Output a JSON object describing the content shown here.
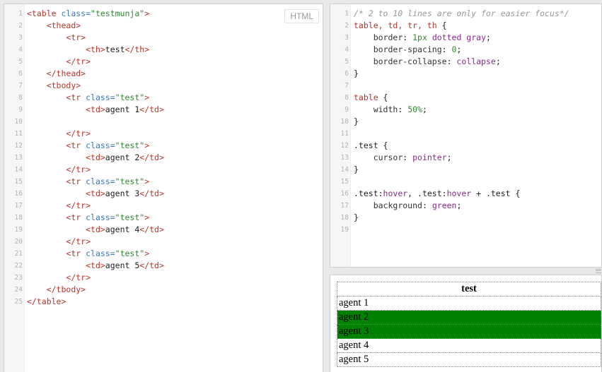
{
  "html_editor": {
    "badge": "HTML",
    "lines": [
      {
        "n": "1",
        "seg": [
          [
            "tag",
            "<table "
          ],
          [
            "attr",
            "class="
          ],
          [
            "str",
            "\"testmunja\""
          ],
          [
            "tag",
            ">"
          ]
        ]
      },
      {
        "n": "2",
        "seg": [
          [
            "plain",
            "    "
          ],
          [
            "tag",
            "<thead>"
          ]
        ]
      },
      {
        "n": "3",
        "seg": [
          [
            "plain",
            "        "
          ],
          [
            "tag",
            "<tr>"
          ]
        ]
      },
      {
        "n": "4",
        "seg": [
          [
            "plain",
            "            "
          ],
          [
            "tag",
            "<th>"
          ],
          [
            "plain",
            "test"
          ],
          [
            "tag",
            "</th>"
          ]
        ]
      },
      {
        "n": "5",
        "seg": [
          [
            "plain",
            "        "
          ],
          [
            "tag",
            "</tr>"
          ]
        ]
      },
      {
        "n": "6",
        "seg": [
          [
            "plain",
            "    "
          ],
          [
            "tag",
            "</thead>"
          ]
        ]
      },
      {
        "n": "7",
        "seg": [
          [
            "plain",
            "    "
          ],
          [
            "tag",
            "<tbody>"
          ]
        ]
      },
      {
        "n": "8",
        "seg": [
          [
            "plain",
            "        "
          ],
          [
            "tag",
            "<tr "
          ],
          [
            "attr",
            "class="
          ],
          [
            "str",
            "\"test\""
          ],
          [
            "tag",
            ">"
          ]
        ]
      },
      {
        "n": "9",
        "seg": [
          [
            "plain",
            "            "
          ],
          [
            "tag",
            "<td>"
          ],
          [
            "plain",
            "agent 1"
          ],
          [
            "tag",
            "</td>"
          ]
        ]
      },
      {
        "n": "10",
        "seg": []
      },
      {
        "n": "11",
        "seg": [
          [
            "plain",
            "        "
          ],
          [
            "tag",
            "</tr>"
          ]
        ]
      },
      {
        "n": "12",
        "seg": [
          [
            "plain",
            "        "
          ],
          [
            "tag",
            "<tr "
          ],
          [
            "attr",
            "class="
          ],
          [
            "str",
            "\"test\""
          ],
          [
            "tag",
            ">"
          ]
        ]
      },
      {
        "n": "13",
        "seg": [
          [
            "plain",
            "            "
          ],
          [
            "tag",
            "<td>"
          ],
          [
            "plain",
            "agent 2"
          ],
          [
            "tag",
            "</td>"
          ]
        ]
      },
      {
        "n": "14",
        "seg": [
          [
            "plain",
            "        "
          ],
          [
            "tag",
            "</tr>"
          ]
        ]
      },
      {
        "n": "15",
        "seg": [
          [
            "plain",
            "        "
          ],
          [
            "tag",
            "<tr "
          ],
          [
            "attr",
            "class="
          ],
          [
            "str",
            "\"test\""
          ],
          [
            "tag",
            ">"
          ]
        ]
      },
      {
        "n": "16",
        "seg": [
          [
            "plain",
            "            "
          ],
          [
            "tag",
            "<td>"
          ],
          [
            "plain",
            "agent 3"
          ],
          [
            "tag",
            "</td>"
          ]
        ]
      },
      {
        "n": "17",
        "seg": [
          [
            "plain",
            "        "
          ],
          [
            "tag",
            "</tr>"
          ]
        ]
      },
      {
        "n": "18",
        "seg": [
          [
            "plain",
            "        "
          ],
          [
            "tag",
            "<tr "
          ],
          [
            "attr",
            "class="
          ],
          [
            "str",
            "\"test\""
          ],
          [
            "tag",
            ">"
          ]
        ]
      },
      {
        "n": "19",
        "seg": [
          [
            "plain",
            "            "
          ],
          [
            "tag",
            "<td>"
          ],
          [
            "plain",
            "agent 4"
          ],
          [
            "tag",
            "</td>"
          ]
        ]
      },
      {
        "n": "20",
        "seg": [
          [
            "plain",
            "        "
          ],
          [
            "tag",
            "</tr>"
          ]
        ]
      },
      {
        "n": "21",
        "seg": [
          [
            "plain",
            "        "
          ],
          [
            "tag",
            "<tr "
          ],
          [
            "attr",
            "class="
          ],
          [
            "str",
            "\"test\""
          ],
          [
            "tag",
            ">"
          ]
        ]
      },
      {
        "n": "22",
        "seg": [
          [
            "plain",
            "            "
          ],
          [
            "tag",
            "<td>"
          ],
          [
            "plain",
            "agent 5"
          ],
          [
            "tag",
            "</td>"
          ]
        ]
      },
      {
        "n": "23",
        "seg": [
          [
            "plain",
            "        "
          ],
          [
            "tag",
            "</tr>"
          ]
        ]
      },
      {
        "n": "24",
        "seg": [
          [
            "plain",
            "    "
          ],
          [
            "tag",
            "</tbody>"
          ]
        ]
      },
      {
        "n": "25",
        "seg": [
          [
            "tag",
            "</table>"
          ]
        ]
      }
    ]
  },
  "css_editor": {
    "lines": [
      {
        "n": "1",
        "seg": [
          [
            "com",
            "/* 2 to 10 lines are only for easier focus*/"
          ]
        ]
      },
      {
        "n": "2",
        "seg": [
          [
            "sel",
            "table, td, tr, th"
          ],
          [
            "plain",
            " {"
          ]
        ]
      },
      {
        "n": "3",
        "seg": [
          [
            "plain",
            "    "
          ],
          [
            "prop",
            "border"
          ],
          [
            "plain",
            ": "
          ],
          [
            "num",
            "1px"
          ],
          [
            "plain",
            " "
          ],
          [
            "val",
            "dotted gray"
          ],
          [
            "plain",
            ";"
          ]
        ]
      },
      {
        "n": "4",
        "seg": [
          [
            "plain",
            "    "
          ],
          [
            "prop",
            "border-spacing"
          ],
          [
            "plain",
            ": "
          ],
          [
            "num",
            "0"
          ],
          [
            "plain",
            ";"
          ]
        ]
      },
      {
        "n": "5",
        "seg": [
          [
            "plain",
            "    "
          ],
          [
            "prop",
            "border-collapse"
          ],
          [
            "plain",
            ": "
          ],
          [
            "val",
            "collapse"
          ],
          [
            "plain",
            ";"
          ]
        ]
      },
      {
        "n": "6",
        "seg": [
          [
            "plain",
            "}"
          ]
        ]
      },
      {
        "n": "7",
        "seg": []
      },
      {
        "n": "8",
        "seg": [
          [
            "sel",
            "table"
          ],
          [
            "plain",
            " {"
          ]
        ]
      },
      {
        "n": "9",
        "seg": [
          [
            "plain",
            "    "
          ],
          [
            "prop",
            "width"
          ],
          [
            "plain",
            ": "
          ],
          [
            "num",
            "50%"
          ],
          [
            "plain",
            ";"
          ]
        ]
      },
      {
        "n": "10",
        "seg": [
          [
            "plain",
            "}"
          ]
        ]
      },
      {
        "n": "11",
        "seg": []
      },
      {
        "n": "12",
        "seg": [
          [
            "plain",
            ".test {"
          ]
        ]
      },
      {
        "n": "13",
        "seg": [
          [
            "plain",
            "    "
          ],
          [
            "prop",
            "cursor"
          ],
          [
            "plain",
            ": "
          ],
          [
            "val",
            "pointer"
          ],
          [
            "plain",
            ";"
          ]
        ]
      },
      {
        "n": "14",
        "seg": [
          [
            "plain",
            "}"
          ]
        ]
      },
      {
        "n": "15",
        "seg": []
      },
      {
        "n": "16",
        "seg": [
          [
            "plain",
            ".test:"
          ],
          [
            "val",
            "hover"
          ],
          [
            "plain",
            ", .test:"
          ],
          [
            "val",
            "hover"
          ],
          [
            "plain",
            " + .test {"
          ]
        ]
      },
      {
        "n": "17",
        "seg": [
          [
            "plain",
            "    "
          ],
          [
            "prop",
            "background"
          ],
          [
            "plain",
            ": "
          ],
          [
            "val",
            "green"
          ],
          [
            "plain",
            ";"
          ]
        ]
      },
      {
        "n": "18",
        "seg": [
          [
            "plain",
            "}"
          ]
        ]
      },
      {
        "n": "19",
        "seg": []
      }
    ]
  },
  "result": {
    "header": "test",
    "rows": [
      {
        "label": "agent 1",
        "highlighted": false
      },
      {
        "label": "agent 2",
        "highlighted": true
      },
      {
        "label": "agent 3",
        "highlighted": true
      },
      {
        "label": "agent 4",
        "highlighted": false
      },
      {
        "label": "agent 5",
        "highlighted": false
      }
    ],
    "highlight_color": "#008000"
  }
}
